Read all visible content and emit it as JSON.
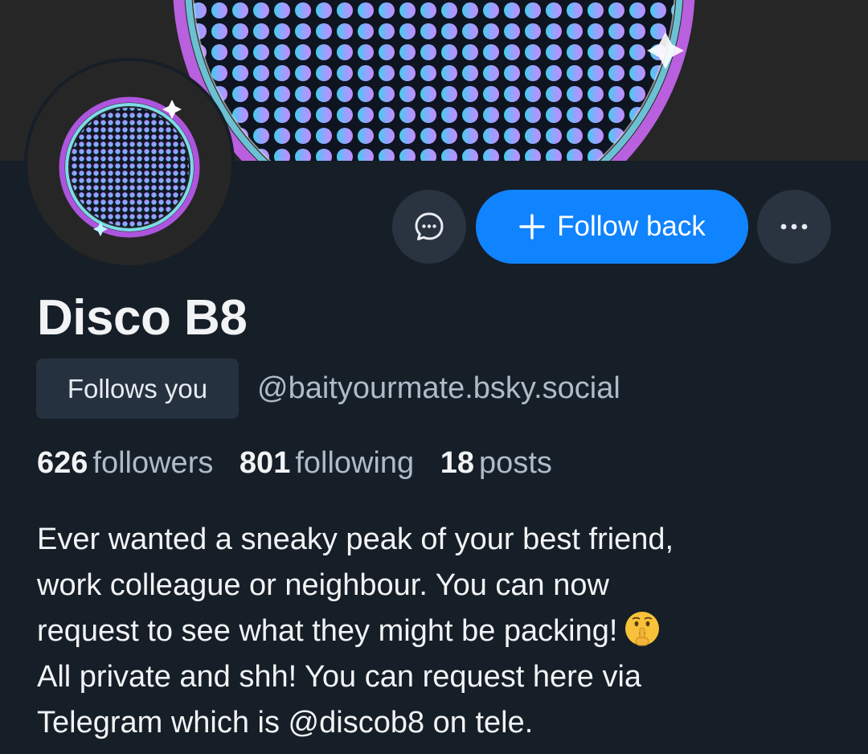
{
  "profile": {
    "display_name": "Disco B8",
    "follows_you_label": "Follows you",
    "handle": "@baityourmate.bsky.social"
  },
  "actions": {
    "message_icon": "chat-bubble-icon",
    "follow_back_label": "Follow back",
    "more_icon": "ellipsis-icon"
  },
  "stats": {
    "followers_count": "626",
    "followers_label": "followers",
    "following_count": "801",
    "following_label": "following",
    "posts_count": "18",
    "posts_label": "posts"
  },
  "bio": {
    "lines": [
      "Ever wanted a sneaky peak of your best friend,",
      "work colleague or neighbour. You can now",
      "request to see what they might be packing!",
      "All private and shh! You can request here via",
      "Telegram which is @discob8 on tele."
    ],
    "emoji_icon": "shushing-face-emoji"
  },
  "colors": {
    "background": "#161e27",
    "accent": "#1083fe",
    "badge_bg": "#263140",
    "muted_text": "#aebbc9"
  }
}
